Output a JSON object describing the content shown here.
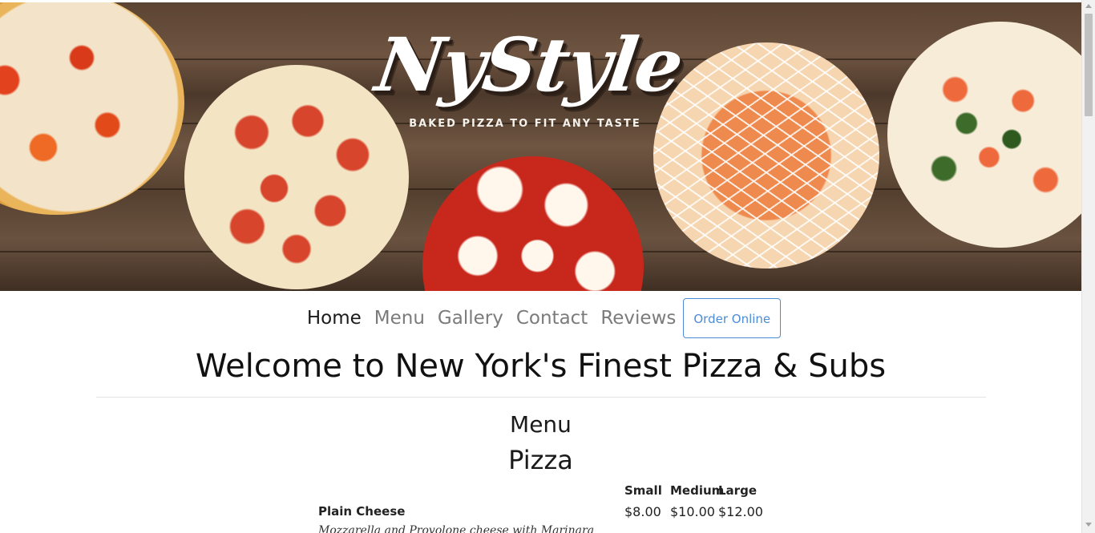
{
  "banner": {
    "logo_text": "NyStyle",
    "tagline": "BAKED PIZZA TO FIT ANY TASTE"
  },
  "nav": {
    "items": [
      {
        "label": "Home",
        "active": true
      },
      {
        "label": "Menu",
        "active": false
      },
      {
        "label": "Gallery",
        "active": false
      },
      {
        "label": "Contact",
        "active": false
      },
      {
        "label": "Reviews",
        "active": false
      }
    ],
    "order_button": "Order Online"
  },
  "main": {
    "welcome_title": "Welcome to New York's Finest Pizza & Subs",
    "menu_heading": "Menu",
    "section_heading": "Pizza",
    "size_headers": [
      "Small",
      "Medium",
      "Large"
    ],
    "items": [
      {
        "name": "Plain Cheese",
        "prices": [
          "$8.00",
          "$10.00",
          "$12.00"
        ],
        "description": "Mozzarella and Provolone cheese with Marinara"
      }
    ]
  },
  "colors": {
    "accent": "#4c8bd6",
    "nav_inactive": "#7b7b7b",
    "nav_active": "#1b1b1b"
  }
}
